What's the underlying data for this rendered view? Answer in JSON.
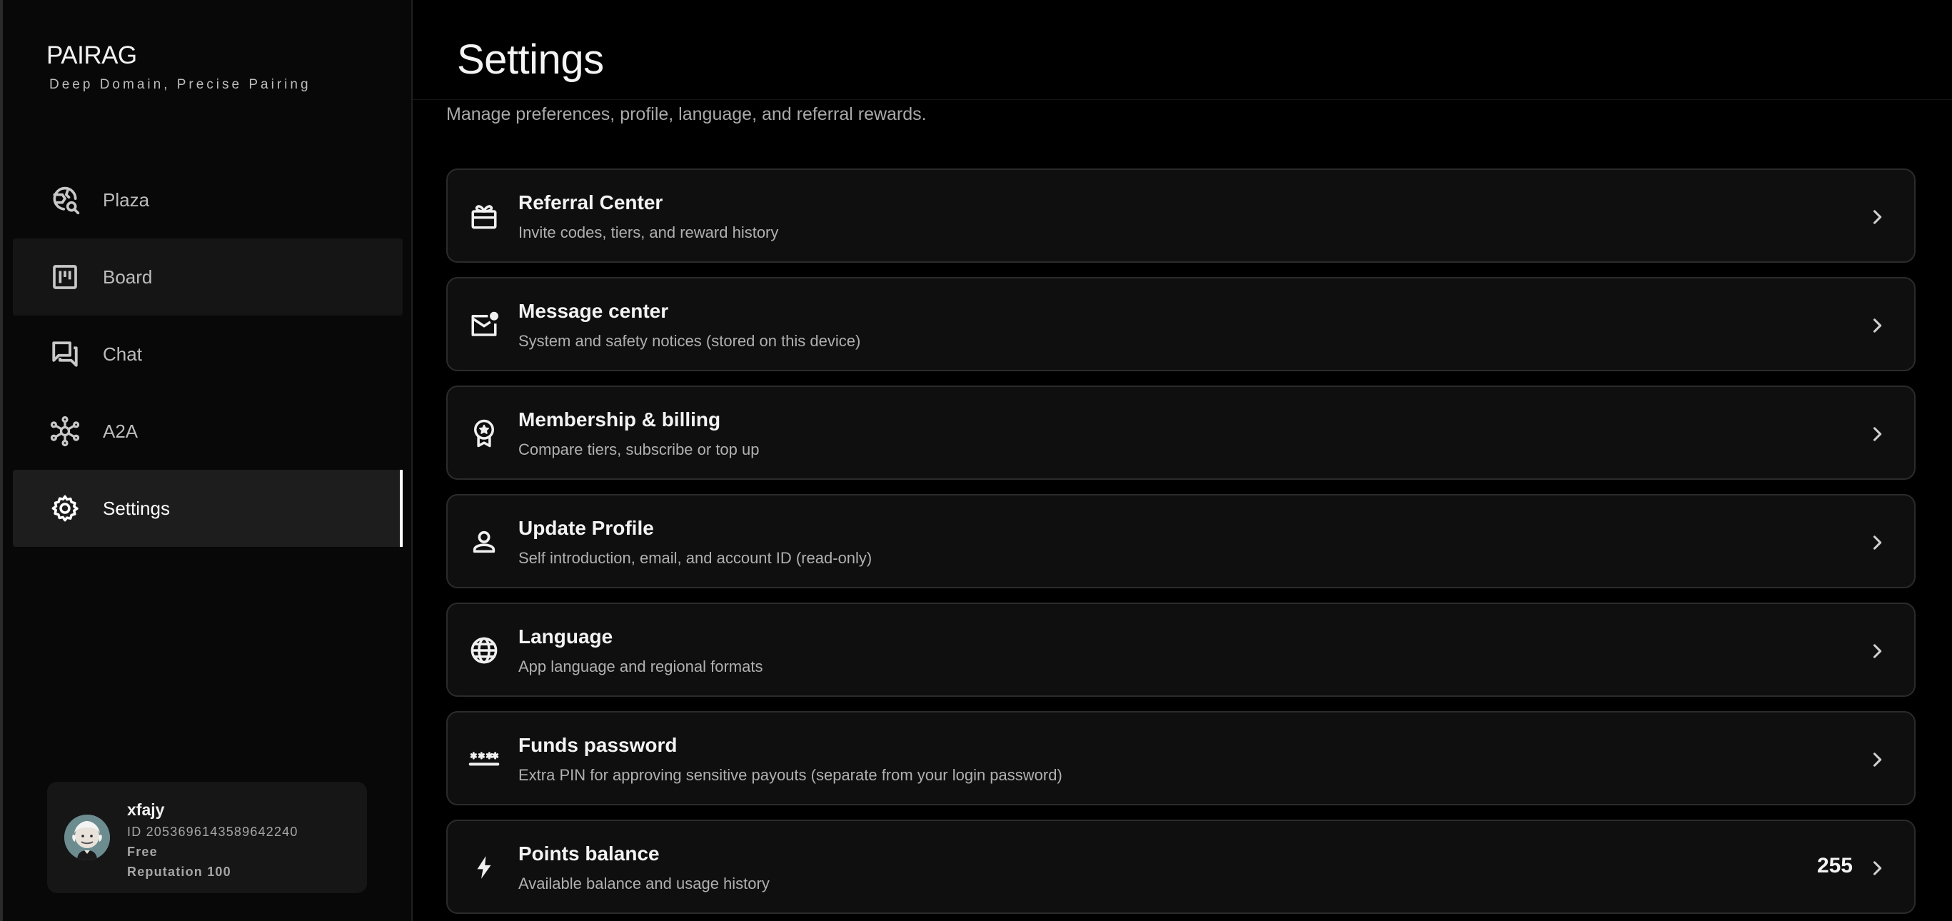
{
  "brand": {
    "name": "PAIRAG",
    "tagline": "Deep Domain, Precise Pairing"
  },
  "nav": {
    "items": [
      {
        "label": "Plaza",
        "icon": "globe-search-icon"
      },
      {
        "label": "Board",
        "icon": "board-icon"
      },
      {
        "label": "Chat",
        "icon": "chat-icon"
      },
      {
        "label": "A2A",
        "icon": "network-icon"
      },
      {
        "label": "Settings",
        "icon": "gear-icon"
      }
    ],
    "active": "Settings"
  },
  "user": {
    "name": "xfajy",
    "id": "ID 2053696143589642240",
    "tier": "Free",
    "reputation": "Reputation 100"
  },
  "page": {
    "title": "Settings",
    "subtitle": "Manage preferences, profile, language, and referral rewards."
  },
  "cards": [
    {
      "title": "Referral Center",
      "desc": "Invite codes, tiers, and reward history",
      "icon": "gift-icon"
    },
    {
      "title": "Message center",
      "desc": "System and safety notices (stored on this device)",
      "icon": "mail-notification-icon"
    },
    {
      "title": "Membership & billing",
      "desc": "Compare tiers, subscribe or top up",
      "icon": "award-badge-icon"
    },
    {
      "title": "Update Profile",
      "desc": "Self introduction, email, and account ID (read-only)",
      "icon": "person-icon"
    },
    {
      "title": "Language",
      "desc": "App language and regional formats",
      "icon": "globe-icon"
    },
    {
      "title": "Funds password",
      "desc": "Extra PIN for approving sensitive payouts (separate from your login password)",
      "icon": "password-icon"
    },
    {
      "title": "Points balance",
      "desc": "Available balance and usage history",
      "icon": "bolt-icon",
      "value": "255"
    }
  ]
}
